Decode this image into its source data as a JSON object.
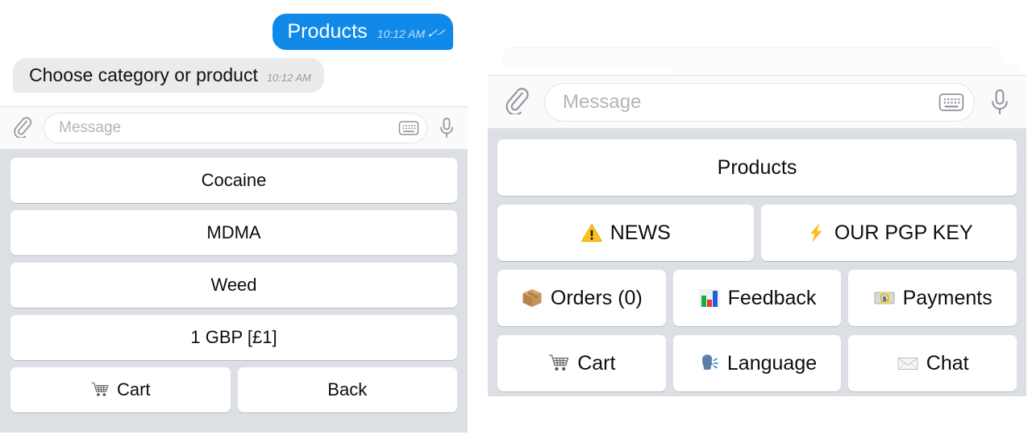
{
  "left_panel": {
    "messages": [
      {
        "id": "outgoing-products",
        "text": "Products",
        "time": "10:12 AM",
        "direction": "outgoing",
        "status_icon": "double-check-icon",
        "bubble_color": "#1089e8",
        "text_color": "#ffffff"
      },
      {
        "id": "incoming-choose",
        "text": "Choose category or product",
        "time": "10:12 AM",
        "direction": "incoming",
        "bubble_color": "#ebebeb",
        "text_color": "#121212"
      }
    ],
    "input_bar": {
      "attach_icon": "paperclip-icon",
      "placeholder": "Message",
      "value": "",
      "keyboard_icon": "keyboard-icon",
      "mic_icon": "microphone-icon"
    },
    "keyboard": {
      "background": "#dcdfe4",
      "rows": [
        [
          {
            "label": "Cocaine",
            "icon": null
          }
        ],
        [
          {
            "label": "MDMA",
            "icon": null
          }
        ],
        [
          {
            "label": "Weed",
            "icon": null
          }
        ],
        [
          {
            "label": "1 GBP [£1]",
            "icon": null
          }
        ],
        [
          {
            "label": "Cart",
            "icon": "shopping-cart-emoji"
          },
          {
            "label": "Back",
            "icon": null
          }
        ]
      ]
    }
  },
  "right_panel": {
    "input_bar": {
      "attach_icon": "paperclip-icon",
      "placeholder": "Message",
      "value": "",
      "keyboard_icon": "keyboard-icon",
      "mic_icon": "microphone-icon"
    },
    "keyboard": {
      "background": "#dcdfe4",
      "rows": [
        [
          {
            "label": "Products",
            "icon": null
          }
        ],
        [
          {
            "label": "NEWS",
            "icon": "warning-emoji"
          },
          {
            "label": "OUR PGP KEY",
            "icon": "high-voltage-emoji"
          }
        ],
        [
          {
            "label": "Orders (0)",
            "icon": "package-emoji"
          },
          {
            "label": "Feedback",
            "icon": "bar-chart-emoji"
          },
          {
            "label": "Payments",
            "icon": "banknote-emoji"
          }
        ],
        [
          {
            "label": "Cart",
            "icon": "shopping-cart-emoji"
          },
          {
            "label": "Language",
            "icon": "speaking-head-emoji"
          },
          {
            "label": "Chat",
            "icon": "envelope-emoji"
          }
        ]
      ]
    }
  },
  "colors": {
    "accent_blue": "#1089e8",
    "incoming_bubble": "#ebebeb",
    "keyboard_bg": "#dcdfe4",
    "key_face": "#ffffff",
    "placeholder": "#b2b5b9"
  }
}
